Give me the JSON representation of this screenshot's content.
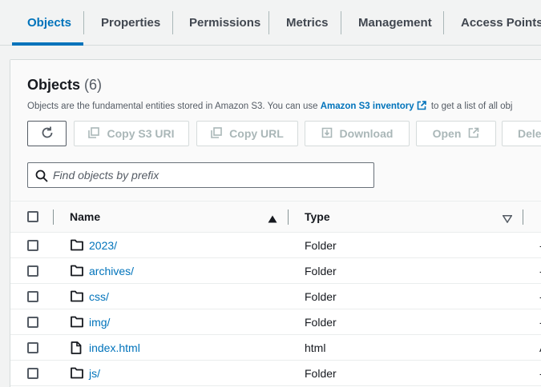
{
  "tabs": [
    {
      "label": "Objects",
      "active": true
    },
    {
      "label": "Properties",
      "active": false
    },
    {
      "label": "Permissions",
      "active": false
    },
    {
      "label": "Metrics",
      "active": false
    },
    {
      "label": "Management",
      "active": false
    },
    {
      "label": "Access Points",
      "active": false
    }
  ],
  "panel": {
    "title": "Objects",
    "count": "(6)",
    "description_prefix": "Objects are the fundamental entities stored in Amazon S3. You can use",
    "description_link": "Amazon S3 inventory",
    "description_suffix": "to get a list of all obj"
  },
  "toolbar": {
    "copy_s3_uri": "Copy S3 URI",
    "copy_url": "Copy URL",
    "download": "Download",
    "open": "Open",
    "delete": "Dele"
  },
  "search": {
    "placeholder": "Find objects by prefix",
    "value": ""
  },
  "table": {
    "columns": {
      "name": "Name",
      "type": "Type"
    },
    "sort": {
      "column": "Name",
      "direction": "ascending"
    },
    "rows": [
      {
        "name": "2023/",
        "type": "Folder",
        "icon": "folder-icon",
        "edge": "-"
      },
      {
        "name": "archives/",
        "type": "Folder",
        "icon": "folder-icon",
        "edge": "-"
      },
      {
        "name": "css/",
        "type": "Folder",
        "icon": "folder-icon",
        "edge": "-"
      },
      {
        "name": "img/",
        "type": "Folder",
        "icon": "folder-icon",
        "edge": "-"
      },
      {
        "name": "index.html",
        "type": "html",
        "icon": "file-icon",
        "edge": "A"
      },
      {
        "name": "js/",
        "type": "Folder",
        "icon": "folder-icon",
        "edge": "-"
      }
    ]
  },
  "colors": {
    "accent": "#0073bb",
    "disabled": "#aab7b8",
    "text": "#16191f"
  }
}
